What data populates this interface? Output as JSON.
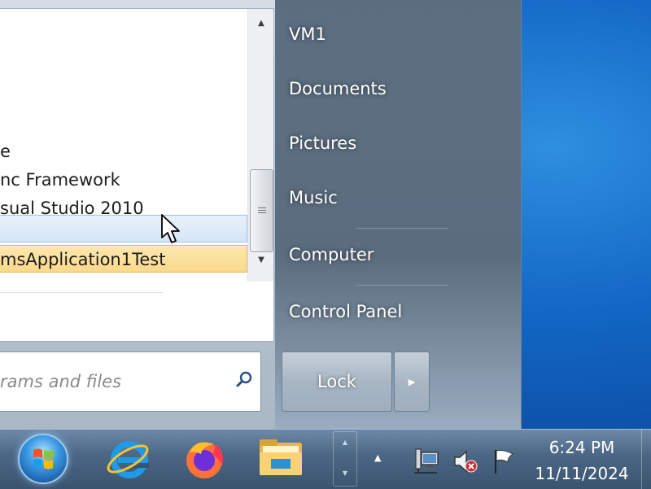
{
  "start_menu": {
    "programs": [
      {
        "label": "e"
      },
      {
        "label": "nc Framework"
      },
      {
        "label": "sual Studio 2010"
      },
      {
        "label": ""
      },
      {
        "label": "msApplication1Test"
      }
    ],
    "search": {
      "placeholder": "rams and files"
    },
    "right_items": [
      {
        "label": "VM1"
      },
      {
        "label": "Documents"
      },
      {
        "label": "Pictures"
      },
      {
        "label": "Music"
      },
      {
        "label": "Computer"
      },
      {
        "label": "Control Panel"
      }
    ],
    "lock_label": "Lock"
  },
  "taskbar": {
    "apps": [
      "internet-explorer-icon",
      "firefox-icon",
      "file-explorer-icon"
    ],
    "tray_icons": [
      "network-icon",
      "volume-muted-icon",
      "action-center-flag-icon"
    ],
    "time": "6:24 PM",
    "date": "11/11/2024"
  },
  "colors": {
    "desktop": "#1266c4",
    "selected_highlight": "#fbd98a",
    "hover_highlight": "#d4e5f6"
  }
}
